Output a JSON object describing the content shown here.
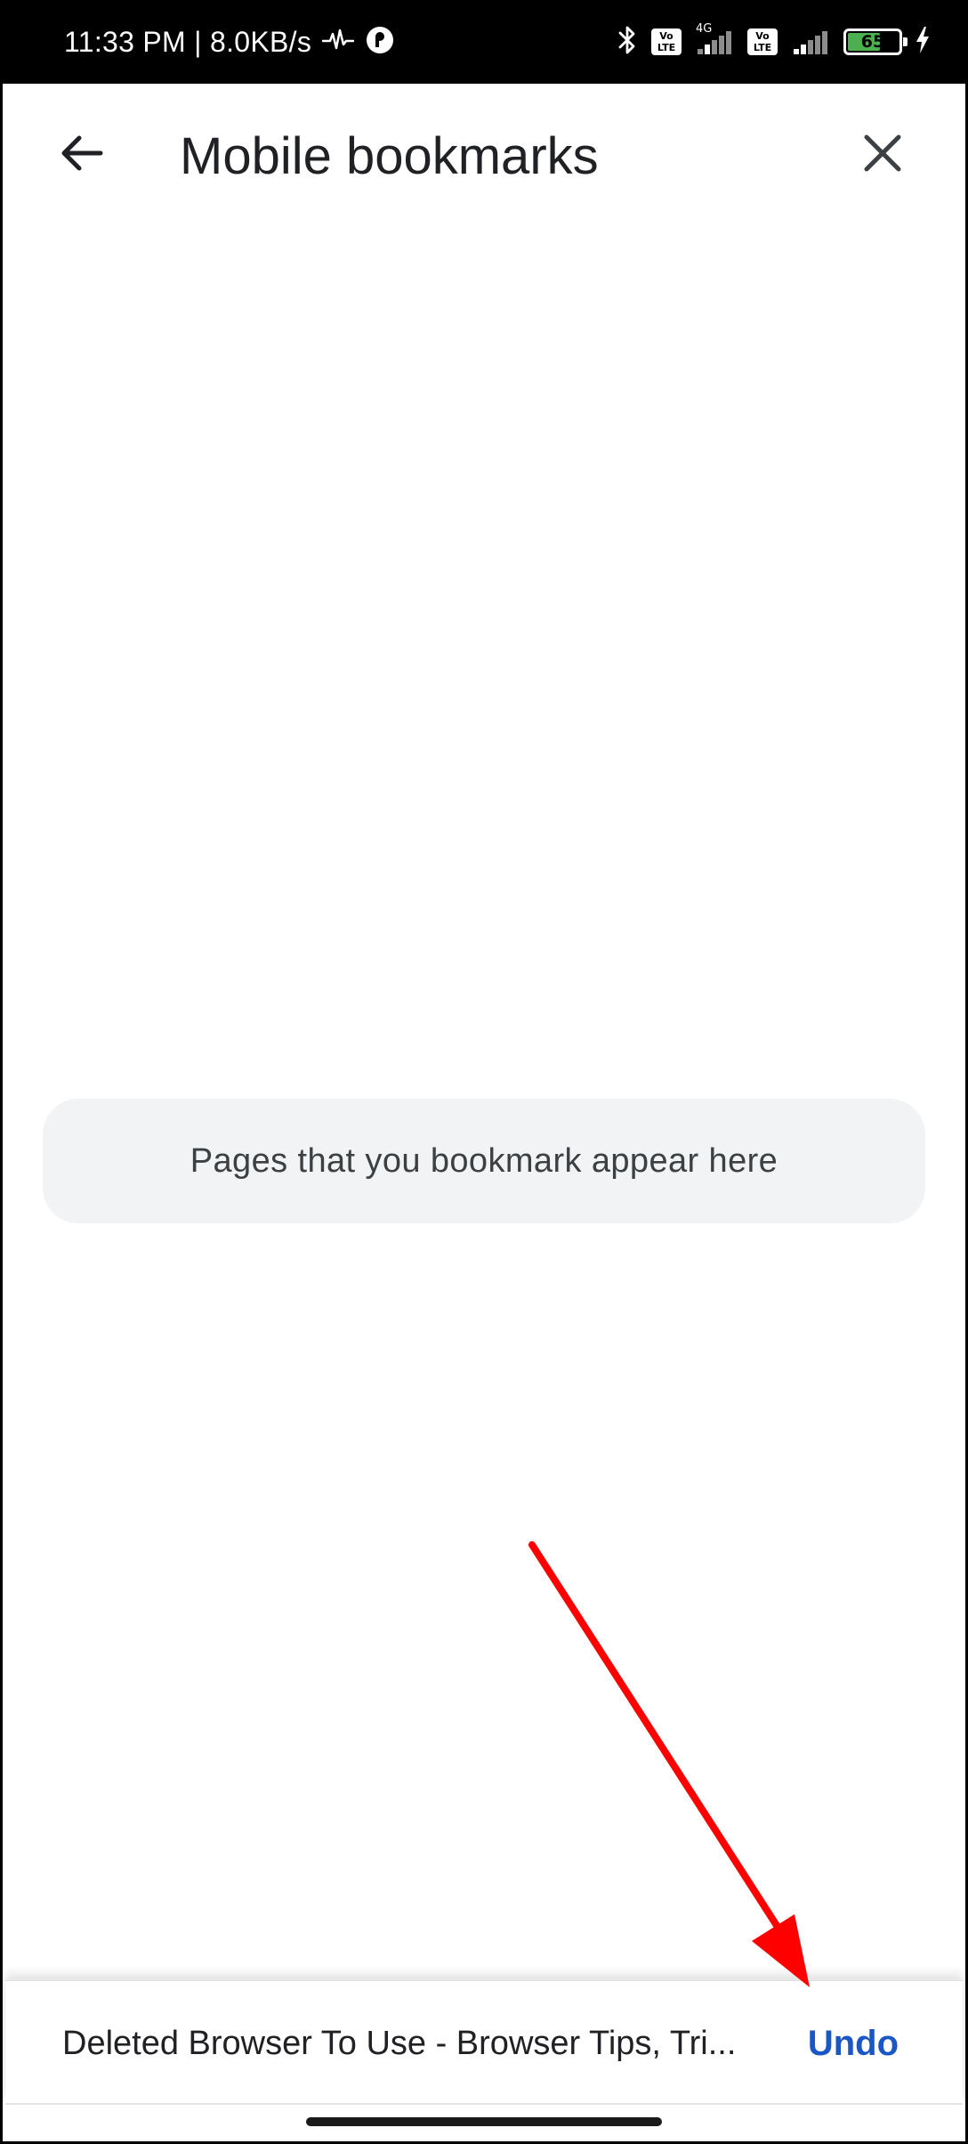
{
  "status_bar": {
    "time_and_speed": "11:33 PM | 8.0KB/s",
    "network_type": "4G",
    "volte_label_1": "Vo\nLTE",
    "volte_label_2": "Vo\nLTE",
    "battery_level": "65",
    "battery_fraction": 0.65,
    "icons": [
      "pulse-icon",
      "app-notification-icon",
      "bluetooth-icon",
      "volte-icon",
      "signal-icon",
      "volte-icon",
      "signal-icon",
      "battery-icon",
      "charging-icon"
    ]
  },
  "app_bar": {
    "title": "Mobile bookmarks",
    "back_icon": "arrow-back-icon",
    "close_icon": "close-icon"
  },
  "empty_state": {
    "message": "Pages that you bookmark appear here"
  },
  "snackbar": {
    "message": "Deleted Browser To Use - Browser Tips, Tri...",
    "action_label": "Undo"
  },
  "colors": {
    "accent": "#1a56c4",
    "annotation_arrow": "#ff0000",
    "card_background": "#f1f3f4",
    "battery_fill": "#4caf50"
  }
}
